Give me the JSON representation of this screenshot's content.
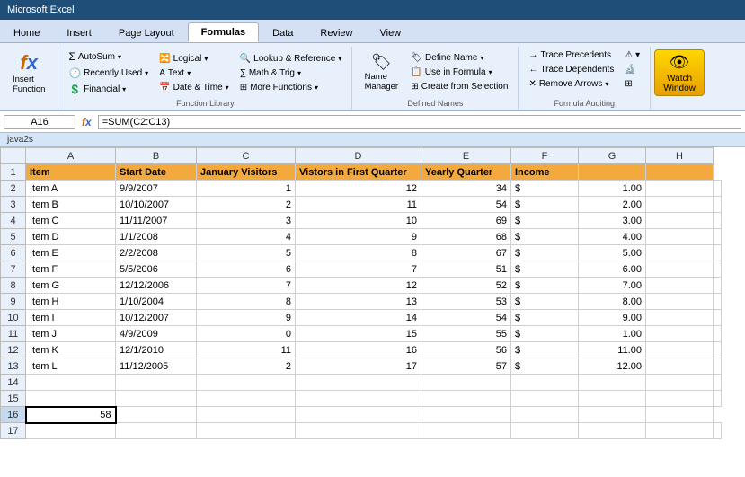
{
  "title": "Microsoft Excel",
  "tabs": [
    {
      "label": "Home",
      "active": false
    },
    {
      "label": "Insert",
      "active": false
    },
    {
      "label": "Page Layout",
      "active": false
    },
    {
      "label": "Formulas",
      "active": true
    },
    {
      "label": "Data",
      "active": false
    },
    {
      "label": "Review",
      "active": false
    },
    {
      "label": "View",
      "active": false
    }
  ],
  "ribbon": {
    "groups": [
      {
        "name": "insert-function-group",
        "label": "",
        "buttons": [
          {
            "label": "Insert\nFunction",
            "icon": "fx"
          }
        ]
      },
      {
        "name": "function-library-group",
        "label": "Function Library",
        "cols": [
          {
            "buttons": [
              "AutoSum ▾",
              "Recently Used ▾",
              "Financial ▾"
            ]
          },
          {
            "buttons": [
              "Logical ▾",
              "Text ▾",
              "Date & Time ▾"
            ]
          },
          {
            "buttons": [
              "Lookup & Reference ▾",
              "Math & Trig ▾",
              "More Functions ▾"
            ]
          }
        ]
      },
      {
        "name": "defined-names-group",
        "label": "Defined Names",
        "cols": [
          {
            "buttons": [
              "Name Manager"
            ]
          },
          {
            "buttons": [
              "Define Name ▾",
              "Use in Formula ▾",
              "Create from Selection"
            ]
          }
        ]
      },
      {
        "name": "formula-auditing-group",
        "label": "Formula Auditing",
        "cols": [
          {
            "buttons": [
              "Trace Precedents",
              "Trace Dependents",
              "Remove Arrows ▾"
            ]
          },
          {
            "buttons": [
              "⚡",
              "🔍",
              "⚙"
            ]
          }
        ]
      }
    ],
    "watch_window": "Watch\nWindow"
  },
  "formula_bar": {
    "name_box": "A16",
    "formula": "=SUM(C2:C13)"
  },
  "sheet_label": "java2s",
  "columns": [
    "",
    "A",
    "B",
    "C",
    "D",
    "E",
    "F",
    "G",
    "H"
  ],
  "header_row": {
    "row": 1,
    "cells": [
      "Item",
      "Start Date",
      "January Visitors",
      "Vistors in First Quarter",
      "Yearly Quarter",
      "Income",
      "",
      ""
    ]
  },
  "data_rows": [
    {
      "row": 2,
      "cells": [
        "Item A",
        "9/9/2007",
        "1",
        "12",
        "34",
        "$",
        "1.00",
        "",
        ""
      ]
    },
    {
      "row": 3,
      "cells": [
        "Item B",
        "10/10/2007",
        "2",
        "11",
        "54",
        "$",
        "2.00",
        "",
        ""
      ]
    },
    {
      "row": 4,
      "cells": [
        "Item C",
        "11/11/2007",
        "3",
        "10",
        "69",
        "$",
        "3.00",
        "",
        ""
      ]
    },
    {
      "row": 5,
      "cells": [
        "Item D",
        "1/1/2008",
        "4",
        "9",
        "68",
        "$",
        "4.00",
        "",
        ""
      ]
    },
    {
      "row": 6,
      "cells": [
        "Item E",
        "2/2/2008",
        "5",
        "8",
        "67",
        "$",
        "5.00",
        "",
        ""
      ]
    },
    {
      "row": 7,
      "cells": [
        "Item F",
        "5/5/2006",
        "6",
        "7",
        "51",
        "$",
        "6.00",
        "",
        ""
      ]
    },
    {
      "row": 8,
      "cells": [
        "Item G",
        "12/12/2006",
        "7",
        "12",
        "52",
        "$",
        "7.00",
        "",
        ""
      ]
    },
    {
      "row": 9,
      "cells": [
        "Item H",
        "1/10/2004",
        "8",
        "13",
        "53",
        "$",
        "8.00",
        "",
        ""
      ]
    },
    {
      "row": 10,
      "cells": [
        "Item I",
        "10/12/2007",
        "9",
        "14",
        "54",
        "$",
        "9.00",
        "",
        ""
      ]
    },
    {
      "row": 11,
      "cells": [
        "Item J",
        "4/9/2009",
        "0",
        "15",
        "55",
        "$",
        "1.00",
        "",
        ""
      ]
    },
    {
      "row": 12,
      "cells": [
        "Item K",
        "12/1/2010",
        "11",
        "16",
        "56",
        "$",
        "11.00",
        "",
        ""
      ]
    },
    {
      "row": 13,
      "cells": [
        "Item L",
        "11/12/2005",
        "2",
        "17",
        "57",
        "$",
        "12.00",
        "",
        ""
      ]
    },
    {
      "row": 14,
      "cells": [
        "",
        "",
        "",
        "",
        "",
        "",
        "",
        "",
        ""
      ]
    },
    {
      "row": 15,
      "cells": [
        "",
        "",
        "",
        "",
        "",
        "",
        "",
        "",
        ""
      ]
    },
    {
      "row": 16,
      "cells": [
        "",
        "",
        "",
        "",
        "",
        "",
        "",
        "",
        ""
      ],
      "selected": true,
      "value": "58"
    },
    {
      "row": 17,
      "cells": [
        "",
        "",
        "",
        "",
        "",
        "",
        "",
        "",
        ""
      ]
    }
  ]
}
